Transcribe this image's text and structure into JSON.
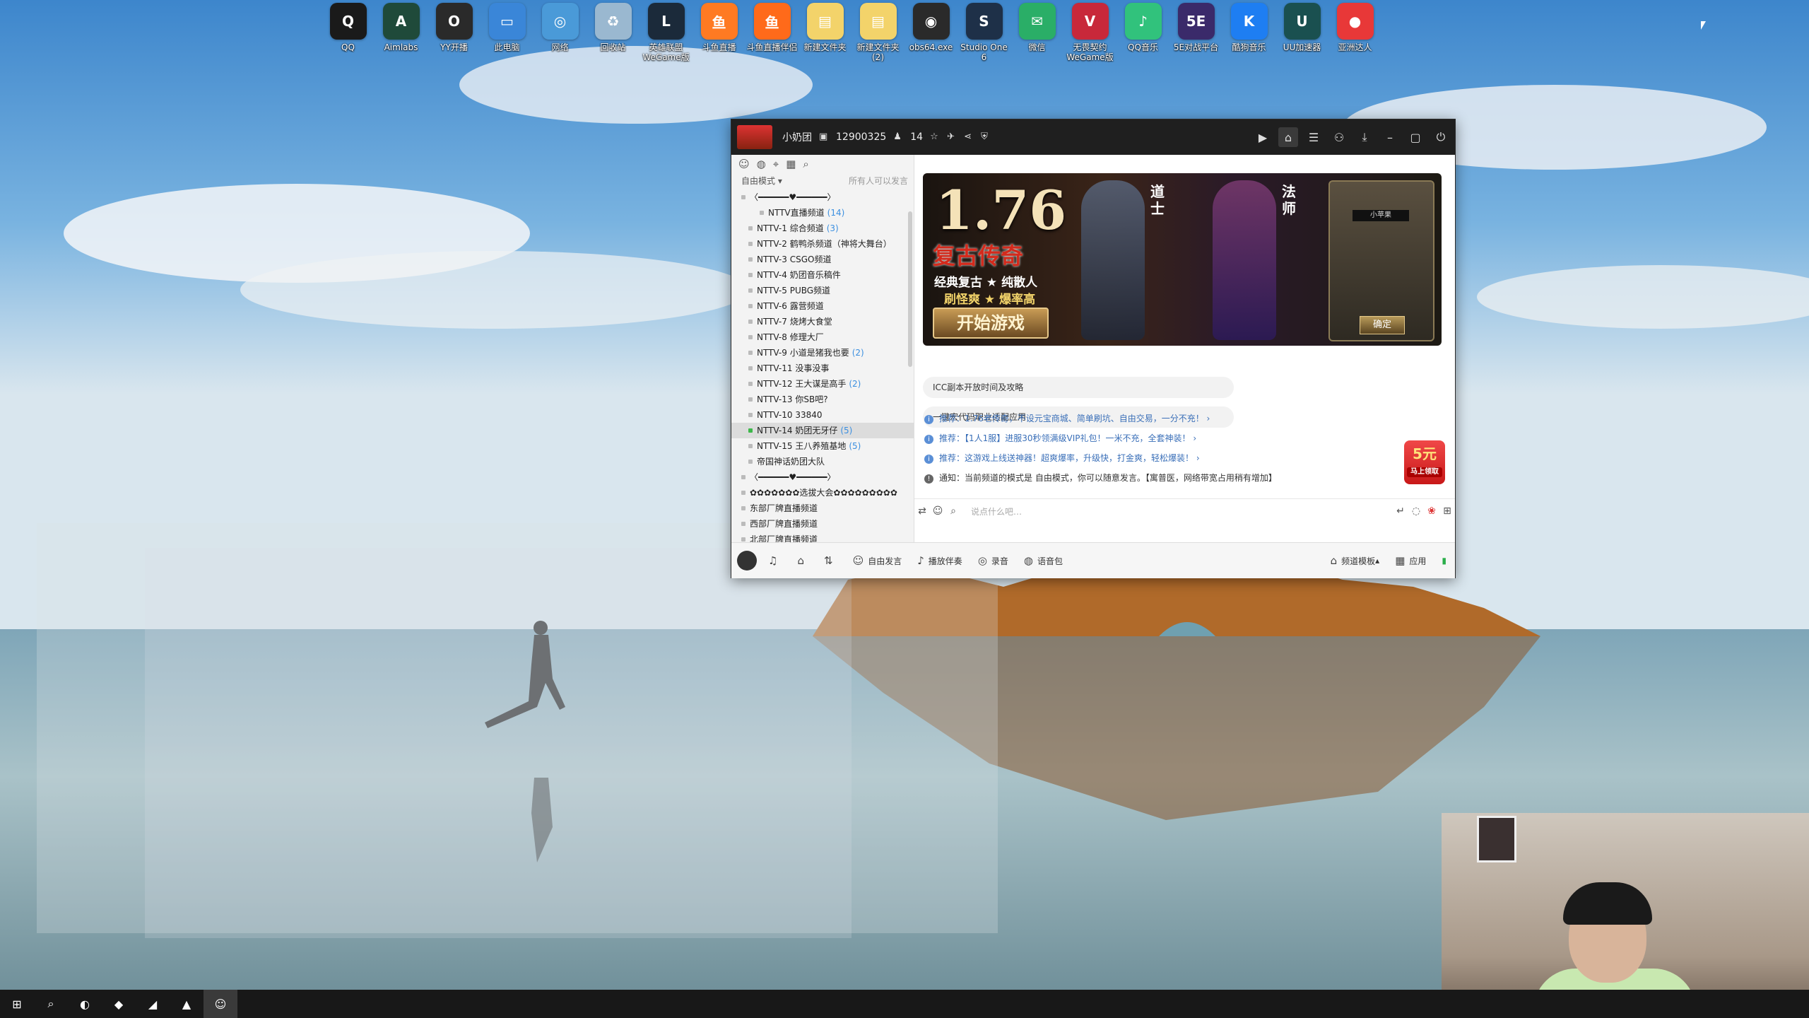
{
  "desktop": {
    "icons": [
      {
        "label": "QQ",
        "icon": "qq-penguin-icon",
        "color": "#1a1a1a",
        "glyph": "Q"
      },
      {
        "label": "Aimlabs",
        "icon": "aimlabs-icon",
        "color": "#1f4a3a",
        "glyph": "A"
      },
      {
        "label": "YY开播",
        "icon": "yy-live-icon",
        "color": "#2a2a2a",
        "glyph": "O"
      },
      {
        "label": "此电脑",
        "icon": "this-pc-icon",
        "color": "#3a86d8",
        "glyph": "▭"
      },
      {
        "label": "网络",
        "icon": "network-icon",
        "color": "#4a9ad8",
        "glyph": "◎"
      },
      {
        "label": "回收站",
        "icon": "recycle-bin-icon",
        "color": "#9ab8d0",
        "glyph": "♻"
      },
      {
        "label": "英雄联盟WeGame版",
        "icon": "league-of-legends-icon",
        "color": "#1b2a3a",
        "glyph": "L"
      },
      {
        "label": "斗鱼直播",
        "icon": "douyu-icon",
        "color": "#ff7a22",
        "glyph": "鱼"
      },
      {
        "label": "斗鱼直播伴侣",
        "icon": "douyu-companion-icon",
        "color": "#ff6a1a",
        "glyph": "鱼"
      },
      {
        "label": "新建文件夹",
        "icon": "folder-icon",
        "color": "#f3d36a",
        "glyph": "▤"
      },
      {
        "label": "新建文件夹 (2)",
        "icon": "folder-zip-icon",
        "color": "#f3d36a",
        "glyph": "▤"
      },
      {
        "label": "obs64.exe",
        "icon": "obs-icon",
        "color": "#2a2a2a",
        "glyph": "◉"
      },
      {
        "label": "Studio One 6",
        "icon": "studio-one-icon",
        "color": "#1e3048",
        "glyph": "S"
      },
      {
        "label": "微信",
        "icon": "wechat-icon",
        "color": "#2aae67",
        "glyph": "✉"
      },
      {
        "label": "无畏契约WeGame版",
        "icon": "valorant-icon",
        "color": "#c8283a",
        "glyph": "V"
      },
      {
        "label": "QQ音乐",
        "icon": "qq-music-icon",
        "color": "#31c27c",
        "glyph": "♪"
      },
      {
        "label": "5E对战平台",
        "icon": "5e-platform-icon",
        "color": "#3a2a6a",
        "glyph": "5E"
      },
      {
        "label": "酷狗音乐",
        "icon": "kugou-icon",
        "color": "#1e7ef2",
        "glyph": "K"
      },
      {
        "label": "UU加速器",
        "icon": "uu-accelerator-icon",
        "color": "#1a5050",
        "glyph": "U"
      },
      {
        "label": "亚洲达人",
        "icon": "app-icon",
        "color": "#e83838",
        "glyph": "●"
      }
    ]
  },
  "yy_window": {
    "title": {
      "channel_name": "小奶团",
      "channel_id": "12900325",
      "online_count": "14"
    },
    "left_panel": {
      "mode": "自由模式",
      "mode_note": "所有人可以发言",
      "channels": [
        {
          "name": "〈━━━━━━♥━━━━━━〉",
          "count": "",
          "indent": 14
        },
        {
          "name": "NTTV直播频道",
          "count": "(14)",
          "indent": 40
        },
        {
          "name": "NTTV-1 综合频道",
          "count": "(3)",
          "indent": 24
        },
        {
          "name": "NTTV-2 鹤鸭杀频道（神将大舞台）",
          "count": "",
          "indent": 24
        },
        {
          "name": "NTTV-3 CSGO频道",
          "count": "",
          "indent": 24
        },
        {
          "name": "NTTV-4 奶团音乐稿件",
          "count": "",
          "indent": 24
        },
        {
          "name": "NTTV-5 PUBG频道",
          "count": "",
          "indent": 24
        },
        {
          "name": "NTTV-6 露营频道",
          "count": "",
          "indent": 24
        },
        {
          "name": "NTTV-7 烧烤大食堂",
          "count": "",
          "indent": 24
        },
        {
          "name": "NTTV-8 修理大厂",
          "count": "",
          "indent": 24
        },
        {
          "name": "NTTV-9 小道是猪我也要",
          "count": "(2)",
          "indent": 24
        },
        {
          "name": "NTTV-11 没事没事",
          "count": "",
          "indent": 24
        },
        {
          "name": "NTTV-12 王大谋是高手",
          "count": "(2)",
          "indent": 24
        },
        {
          "name": "NTTV-13 你SB吧?",
          "count": "",
          "indent": 24
        },
        {
          "name": "NTTV-10 33840",
          "count": "",
          "indent": 24
        },
        {
          "name": "NTTV-14 奶团无牙仔",
          "count": "(5)",
          "indent": 24,
          "selected": true
        },
        {
          "name": "NTTV-15 王八养殖基地",
          "count": "(5)",
          "indent": 24
        },
        {
          "name": "帝国神话奶团大队",
          "count": "",
          "indent": 24
        },
        {
          "name": "〈━━━━━━♥━━━━━━〉",
          "count": "",
          "indent": 14
        },
        {
          "name": "✿✿✿✿✿✿✿选拔大会✿✿✿✿✿✿✿✿✿",
          "count": "",
          "indent": 14
        },
        {
          "name": "东部厂牌直播频道",
          "count": "",
          "indent": 14
        },
        {
          "name": "西部厂牌直播频道",
          "count": "",
          "indent": 14
        },
        {
          "name": "北部厂牌直播频道",
          "count": "",
          "indent": 14
        }
      ]
    },
    "banner": {
      "version": "1.76",
      "title": "复古传奇",
      "line1": "经典复古 ★ 纯散人",
      "line2": "刷怪爽 ★ 爆率高",
      "start_button": "开始游戏",
      "class1": "道士",
      "class2": "法师",
      "panel_name": "小苹果",
      "confirm_button": "确定"
    },
    "quick_links": [
      "ICC副本开放时间及攻略",
      "一键宏代码职业适配应用"
    ],
    "notices": [
      {
        "text": "推荐：1.76老传奇，不设元宝商城、简单刷坑、自由交易，一分不充！ ›",
        "type": "info"
      },
      {
        "text": "推荐：【1人1服】进服30秒领满级VIP礼包！一米不充，全套神装！ ›",
        "type": "info"
      },
      {
        "text": "推荐：这游戏上线送神器！超爽爆率，升级快，打金爽，轻松爆装！ ›",
        "type": "info"
      },
      {
        "text": "通知：当前频道的模式是 自由模式，你可以随意发言。【寓普医，网络带宽占用稍有增加】",
        "type": "sys"
      }
    ],
    "red_packet": {
      "amount": "5元",
      "label": "马上领取"
    },
    "input_placeholder": "说点什么吧…",
    "bottom_bar": {
      "free_speech": "自由发言",
      "accompany": "播放伴奏",
      "record": "录音",
      "voice_pack": "语音包",
      "template": "频道模板",
      "apps": "应用"
    }
  },
  "taskbar": {
    "items": [
      {
        "name": "windows-start-icon",
        "glyph": "⊞"
      },
      {
        "name": "search-icon",
        "glyph": "⌕"
      },
      {
        "name": "edge-browser-icon",
        "glyph": "◐"
      },
      {
        "name": "douyu-taskbar-icon",
        "glyph": "◆"
      },
      {
        "name": "studio-one-taskbar-icon",
        "glyph": "◢"
      },
      {
        "name": "aimlabs-taskbar-icon",
        "glyph": "▲"
      },
      {
        "name": "yy-taskbar-icon",
        "glyph": "☺"
      }
    ]
  }
}
